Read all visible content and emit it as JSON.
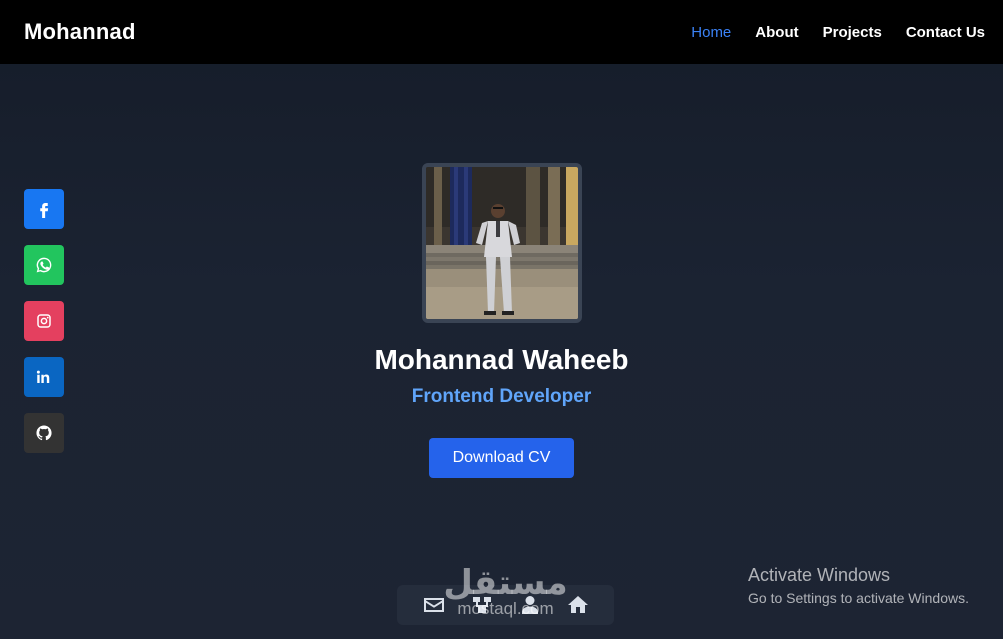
{
  "navbar": {
    "brand": "Mohannad",
    "links": [
      {
        "label": "Home",
        "active": true
      },
      {
        "label": "About"
      },
      {
        "label": "Projects"
      },
      {
        "label": "Contact Us"
      }
    ],
    "accent_color": "#3b82f6"
  },
  "social": [
    {
      "name": "facebook",
      "icon": "facebook-icon",
      "color": "#1877f2"
    },
    {
      "name": "whatsapp",
      "icon": "whatsapp-icon",
      "color": "#22c55e"
    },
    {
      "name": "instagram",
      "icon": "instagram-icon",
      "color": "#e4405f"
    },
    {
      "name": "linkedin",
      "icon": "linkedin-icon",
      "color": "#0a66c2"
    },
    {
      "name": "github",
      "icon": "github-icon",
      "color": "#333333"
    }
  ],
  "hero": {
    "name": "Mohannad Waheeb",
    "role": "Frontend Developer",
    "cv_button": "Download CV",
    "cv_button_color": "#2563eb"
  },
  "bottom_nav": {
    "icons": [
      "mail-icon",
      "projects-icon",
      "user-icon",
      "home-icon"
    ]
  },
  "watermark": {
    "arabic": "مستقل",
    "latin": "mostaql.com"
  },
  "windows_activation": {
    "title": "Activate Windows",
    "subtitle": "Go to Settings to activate Windows."
  }
}
